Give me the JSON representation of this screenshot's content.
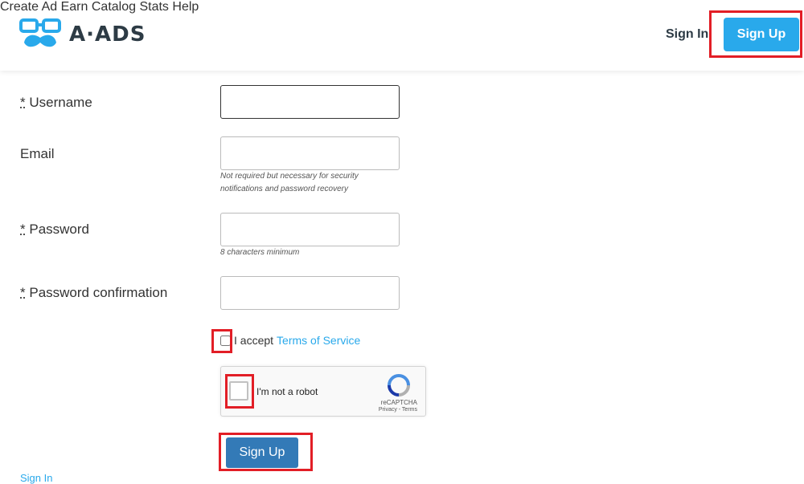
{
  "header": {
    "logo_text": "A·ADS",
    "nav": [
      "Create Ad",
      "Earn",
      "Catalog",
      "Stats",
      "Help"
    ],
    "sign_in": "Sign In",
    "sign_up": "Sign Up"
  },
  "form": {
    "required_marker": "*",
    "username_label": "Username",
    "email_label": "Email",
    "email_hint_line1": "Not required but necessary for security",
    "email_hint_line2": "notifications and password recovery",
    "password_label": "Password",
    "password_hint": "8 characters minimum",
    "password_confirmation_label": "Password confirmation",
    "accept_text": "I accept",
    "terms_link": "Terms of Service",
    "recaptcha_text": "I'm not a robot",
    "recaptcha_brand": "reCAPTCHA",
    "recaptcha_links": "Privacy - Terms",
    "submit": "Sign Up",
    "bottom_link": "Sign In"
  },
  "colors": {
    "accent": "#29a9eb",
    "submit": "#337ab7",
    "highlight": "#e21e26"
  }
}
